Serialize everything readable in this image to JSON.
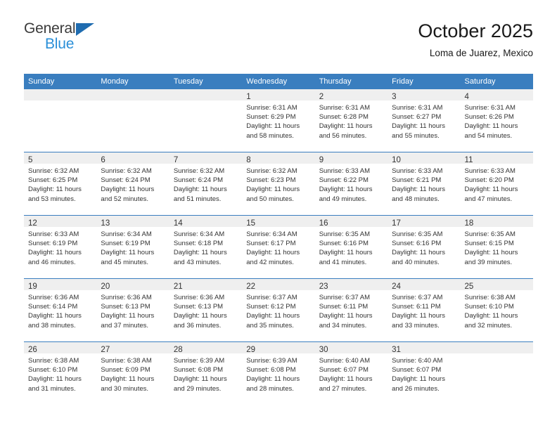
{
  "brand": {
    "word1": "General",
    "word2": "Blue",
    "triangle_color": "#1f6cb0",
    "word2_color": "#2a8fd8"
  },
  "header": {
    "title": "October 2025",
    "subtitle": "Loma de Juarez, Mexico"
  },
  "theme": {
    "header_blue": "#3a7ebf",
    "daynum_band": "#efefef",
    "text": "#333333"
  },
  "weekday_headers": [
    "Sunday",
    "Monday",
    "Tuesday",
    "Wednesday",
    "Thursday",
    "Friday",
    "Saturday"
  ],
  "weeks": [
    [
      {
        "day": "",
        "lines": []
      },
      {
        "day": "",
        "lines": []
      },
      {
        "day": "",
        "lines": []
      },
      {
        "day": "1",
        "lines": [
          "Sunrise: 6:31 AM",
          "Sunset: 6:29 PM",
          "Daylight: 11 hours",
          "and 58 minutes."
        ]
      },
      {
        "day": "2",
        "lines": [
          "Sunrise: 6:31 AM",
          "Sunset: 6:28 PM",
          "Daylight: 11 hours",
          "and 56 minutes."
        ]
      },
      {
        "day": "3",
        "lines": [
          "Sunrise: 6:31 AM",
          "Sunset: 6:27 PM",
          "Daylight: 11 hours",
          "and 55 minutes."
        ]
      },
      {
        "day": "4",
        "lines": [
          "Sunrise: 6:31 AM",
          "Sunset: 6:26 PM",
          "Daylight: 11 hours",
          "and 54 minutes."
        ]
      }
    ],
    [
      {
        "day": "5",
        "lines": [
          "Sunrise: 6:32 AM",
          "Sunset: 6:25 PM",
          "Daylight: 11 hours",
          "and 53 minutes."
        ]
      },
      {
        "day": "6",
        "lines": [
          "Sunrise: 6:32 AM",
          "Sunset: 6:24 PM",
          "Daylight: 11 hours",
          "and 52 minutes."
        ]
      },
      {
        "day": "7",
        "lines": [
          "Sunrise: 6:32 AM",
          "Sunset: 6:24 PM",
          "Daylight: 11 hours",
          "and 51 minutes."
        ]
      },
      {
        "day": "8",
        "lines": [
          "Sunrise: 6:32 AM",
          "Sunset: 6:23 PM",
          "Daylight: 11 hours",
          "and 50 minutes."
        ]
      },
      {
        "day": "9",
        "lines": [
          "Sunrise: 6:33 AM",
          "Sunset: 6:22 PM",
          "Daylight: 11 hours",
          "and 49 minutes."
        ]
      },
      {
        "day": "10",
        "lines": [
          "Sunrise: 6:33 AM",
          "Sunset: 6:21 PM",
          "Daylight: 11 hours",
          "and 48 minutes."
        ]
      },
      {
        "day": "11",
        "lines": [
          "Sunrise: 6:33 AM",
          "Sunset: 6:20 PM",
          "Daylight: 11 hours",
          "and 47 minutes."
        ]
      }
    ],
    [
      {
        "day": "12",
        "lines": [
          "Sunrise: 6:33 AM",
          "Sunset: 6:19 PM",
          "Daylight: 11 hours",
          "and 46 minutes."
        ]
      },
      {
        "day": "13",
        "lines": [
          "Sunrise: 6:34 AM",
          "Sunset: 6:19 PM",
          "Daylight: 11 hours",
          "and 45 minutes."
        ]
      },
      {
        "day": "14",
        "lines": [
          "Sunrise: 6:34 AM",
          "Sunset: 6:18 PM",
          "Daylight: 11 hours",
          "and 43 minutes."
        ]
      },
      {
        "day": "15",
        "lines": [
          "Sunrise: 6:34 AM",
          "Sunset: 6:17 PM",
          "Daylight: 11 hours",
          "and 42 minutes."
        ]
      },
      {
        "day": "16",
        "lines": [
          "Sunrise: 6:35 AM",
          "Sunset: 6:16 PM",
          "Daylight: 11 hours",
          "and 41 minutes."
        ]
      },
      {
        "day": "17",
        "lines": [
          "Sunrise: 6:35 AM",
          "Sunset: 6:16 PM",
          "Daylight: 11 hours",
          "and 40 minutes."
        ]
      },
      {
        "day": "18",
        "lines": [
          "Sunrise: 6:35 AM",
          "Sunset: 6:15 PM",
          "Daylight: 11 hours",
          "and 39 minutes."
        ]
      }
    ],
    [
      {
        "day": "19",
        "lines": [
          "Sunrise: 6:36 AM",
          "Sunset: 6:14 PM",
          "Daylight: 11 hours",
          "and 38 minutes."
        ]
      },
      {
        "day": "20",
        "lines": [
          "Sunrise: 6:36 AM",
          "Sunset: 6:13 PM",
          "Daylight: 11 hours",
          "and 37 minutes."
        ]
      },
      {
        "day": "21",
        "lines": [
          "Sunrise: 6:36 AM",
          "Sunset: 6:13 PM",
          "Daylight: 11 hours",
          "and 36 minutes."
        ]
      },
      {
        "day": "22",
        "lines": [
          "Sunrise: 6:37 AM",
          "Sunset: 6:12 PM",
          "Daylight: 11 hours",
          "and 35 minutes."
        ]
      },
      {
        "day": "23",
        "lines": [
          "Sunrise: 6:37 AM",
          "Sunset: 6:11 PM",
          "Daylight: 11 hours",
          "and 34 minutes."
        ]
      },
      {
        "day": "24",
        "lines": [
          "Sunrise: 6:37 AM",
          "Sunset: 6:11 PM",
          "Daylight: 11 hours",
          "and 33 minutes."
        ]
      },
      {
        "day": "25",
        "lines": [
          "Sunrise: 6:38 AM",
          "Sunset: 6:10 PM",
          "Daylight: 11 hours",
          "and 32 minutes."
        ]
      }
    ],
    [
      {
        "day": "26",
        "lines": [
          "Sunrise: 6:38 AM",
          "Sunset: 6:10 PM",
          "Daylight: 11 hours",
          "and 31 minutes."
        ]
      },
      {
        "day": "27",
        "lines": [
          "Sunrise: 6:38 AM",
          "Sunset: 6:09 PM",
          "Daylight: 11 hours",
          "and 30 minutes."
        ]
      },
      {
        "day": "28",
        "lines": [
          "Sunrise: 6:39 AM",
          "Sunset: 6:08 PM",
          "Daylight: 11 hours",
          "and 29 minutes."
        ]
      },
      {
        "day": "29",
        "lines": [
          "Sunrise: 6:39 AM",
          "Sunset: 6:08 PM",
          "Daylight: 11 hours",
          "and 28 minutes."
        ]
      },
      {
        "day": "30",
        "lines": [
          "Sunrise: 6:40 AM",
          "Sunset: 6:07 PM",
          "Daylight: 11 hours",
          "and 27 minutes."
        ]
      },
      {
        "day": "31",
        "lines": [
          "Sunrise: 6:40 AM",
          "Sunset: 6:07 PM",
          "Daylight: 11 hours",
          "and 26 minutes."
        ]
      },
      {
        "day": "",
        "lines": []
      }
    ]
  ]
}
